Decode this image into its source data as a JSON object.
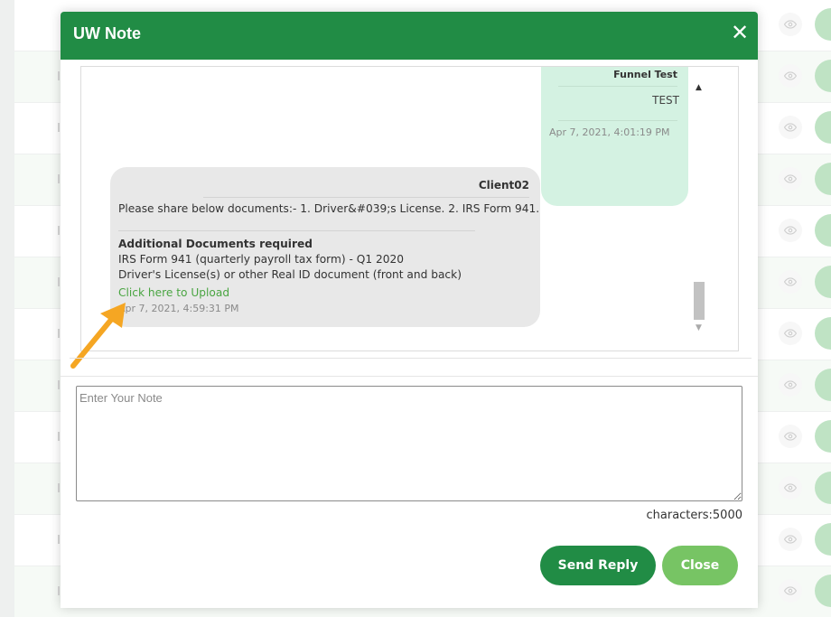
{
  "modal": {
    "title": "UW Note",
    "close_glyph": "✕"
  },
  "messages": {
    "mine": {
      "sender": "Funnel Test",
      "text": "TEST",
      "time": "Apr 7, 2021, 4:01:19 PM"
    },
    "other": {
      "sender": "Client02",
      "text": "Please share below documents:- 1. Driver&#039;s License. 2. IRS Form 941.",
      "additional_title": "Additional Documents required",
      "doc_1": "IRS Form 941 (quarterly payroll tax form) - Q1 2020",
      "doc_2": "Driver's License(s) or other Real ID document (front and back)",
      "upload_link": "Click here to Upload",
      "time": "Apr 7, 2021, 4:59:31 PM"
    }
  },
  "note": {
    "placeholder": "Enter Your Note",
    "value": ""
  },
  "char_count": "characters:5000",
  "buttons": {
    "send": "Send Reply",
    "close": "Close"
  },
  "icons": {
    "row_view": "eye-icon",
    "annotation": "arrow-icon",
    "scroll_up": "caret-up-icon",
    "scroll_down": "caret-down-icon"
  },
  "colors": {
    "header": "#218c45",
    "send_button": "#218c45",
    "close_button": "#77c464",
    "link": "#4aa542",
    "my_bubble": "#d4f2e2",
    "other_bubble": "#e8e8e8",
    "arrow": "#f5a623"
  }
}
